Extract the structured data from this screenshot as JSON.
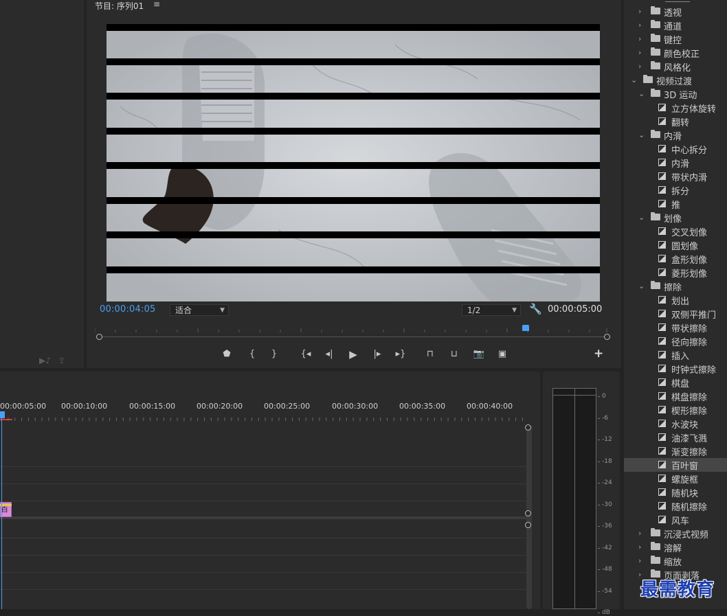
{
  "program_monitor": {
    "title": "节目: 序列01",
    "menu_icon": "hamburger-icon",
    "current_time": "00:00:04:05",
    "fit_select": "适合",
    "quality_select": "1/2",
    "duration": "00:00:05:00",
    "transport_icons": [
      "marker-icon",
      "in-point-icon",
      "out-point-icon",
      "go-to-in-icon",
      "step-back-icon",
      "play-icon",
      "step-forward-icon",
      "go-to-out-icon",
      "lift-icon",
      "extract-icon",
      "camera-icon",
      "multicam-icon"
    ],
    "add_icon": "plus-icon"
  },
  "timeline": {
    "ruler_labels": [
      "00:00:05:00",
      "00:00:10:00",
      "00:00:15:00",
      "00:00:20:00",
      "00:00:25:00",
      "00:00:30:00",
      "00:00:35:00",
      "00:00:40:00"
    ],
    "clip_label": "百叶"
  },
  "audio_meter": {
    "labels": [
      "0",
      "-6",
      "-12",
      "-18",
      "-24",
      "-30",
      "-36",
      "-42",
      "-48",
      "-54",
      "dB"
    ]
  },
  "effects_tree": [
    {
      "label": "透视",
      "level": 1,
      "type": "folder",
      "expanded": false
    },
    {
      "label": "通道",
      "level": 1,
      "type": "folder",
      "expanded": false
    },
    {
      "label": "键控",
      "level": 1,
      "type": "folder",
      "expanded": false
    },
    {
      "label": "颜色校正",
      "level": 1,
      "type": "folder",
      "expanded": false
    },
    {
      "label": "风格化",
      "level": 1,
      "type": "folder",
      "expanded": false
    },
    {
      "label": "视频过渡",
      "level": 0,
      "type": "folder",
      "expanded": true
    },
    {
      "label": "3D 运动",
      "level": 1,
      "type": "folder",
      "expanded": true
    },
    {
      "label": "立方体旋转",
      "level": 2,
      "type": "effect"
    },
    {
      "label": "翻转",
      "level": 2,
      "type": "effect"
    },
    {
      "label": "内滑",
      "level": 1,
      "type": "folder",
      "expanded": true
    },
    {
      "label": "中心拆分",
      "level": 2,
      "type": "effect"
    },
    {
      "label": "内滑",
      "level": 2,
      "type": "effect"
    },
    {
      "label": "带状内滑",
      "level": 2,
      "type": "effect"
    },
    {
      "label": "拆分",
      "level": 2,
      "type": "effect"
    },
    {
      "label": "推",
      "level": 2,
      "type": "effect"
    },
    {
      "label": "划像",
      "level": 1,
      "type": "folder",
      "expanded": true
    },
    {
      "label": "交叉划像",
      "level": 2,
      "type": "effect"
    },
    {
      "label": "圆划像",
      "level": 2,
      "type": "effect"
    },
    {
      "label": "盒形划像",
      "level": 2,
      "type": "effect"
    },
    {
      "label": "菱形划像",
      "level": 2,
      "type": "effect"
    },
    {
      "label": "擦除",
      "level": 1,
      "type": "folder",
      "expanded": true
    },
    {
      "label": "划出",
      "level": 2,
      "type": "effect"
    },
    {
      "label": "双侧平推门",
      "level": 2,
      "type": "effect"
    },
    {
      "label": "带状擦除",
      "level": 2,
      "type": "effect"
    },
    {
      "label": "径向擦除",
      "level": 2,
      "type": "effect"
    },
    {
      "label": "插入",
      "level": 2,
      "type": "effect"
    },
    {
      "label": "时钟式擦除",
      "level": 2,
      "type": "effect"
    },
    {
      "label": "棋盘",
      "level": 2,
      "type": "effect"
    },
    {
      "label": "棋盘擦除",
      "level": 2,
      "type": "effect"
    },
    {
      "label": "楔形擦除",
      "level": 2,
      "type": "effect"
    },
    {
      "label": "水波块",
      "level": 2,
      "type": "effect"
    },
    {
      "label": "油漆飞溅",
      "level": 2,
      "type": "effect"
    },
    {
      "label": "渐变擦除",
      "level": 2,
      "type": "effect"
    },
    {
      "label": "百叶窗",
      "level": 2,
      "type": "effect",
      "selected": true
    },
    {
      "label": "螺旋框",
      "level": 2,
      "type": "effect"
    },
    {
      "label": "随机块",
      "level": 2,
      "type": "effect"
    },
    {
      "label": "随机擦除",
      "level": 2,
      "type": "effect"
    },
    {
      "label": "风车",
      "level": 2,
      "type": "effect"
    },
    {
      "label": "沉浸式视频",
      "level": 1,
      "type": "folder",
      "expanded": false
    },
    {
      "label": "溶解",
      "level": 1,
      "type": "folder",
      "expanded": false
    },
    {
      "label": "缩放",
      "level": 1,
      "type": "folder",
      "expanded": false
    },
    {
      "label": "页面剥落",
      "level": 1,
      "type": "folder",
      "expanded": false
    }
  ],
  "watermark": "最需教育",
  "colors": {
    "accent": "#4a9ff5",
    "panel": "#2b2b2b",
    "clip": "#d889d8",
    "selected_row": "#464646"
  }
}
